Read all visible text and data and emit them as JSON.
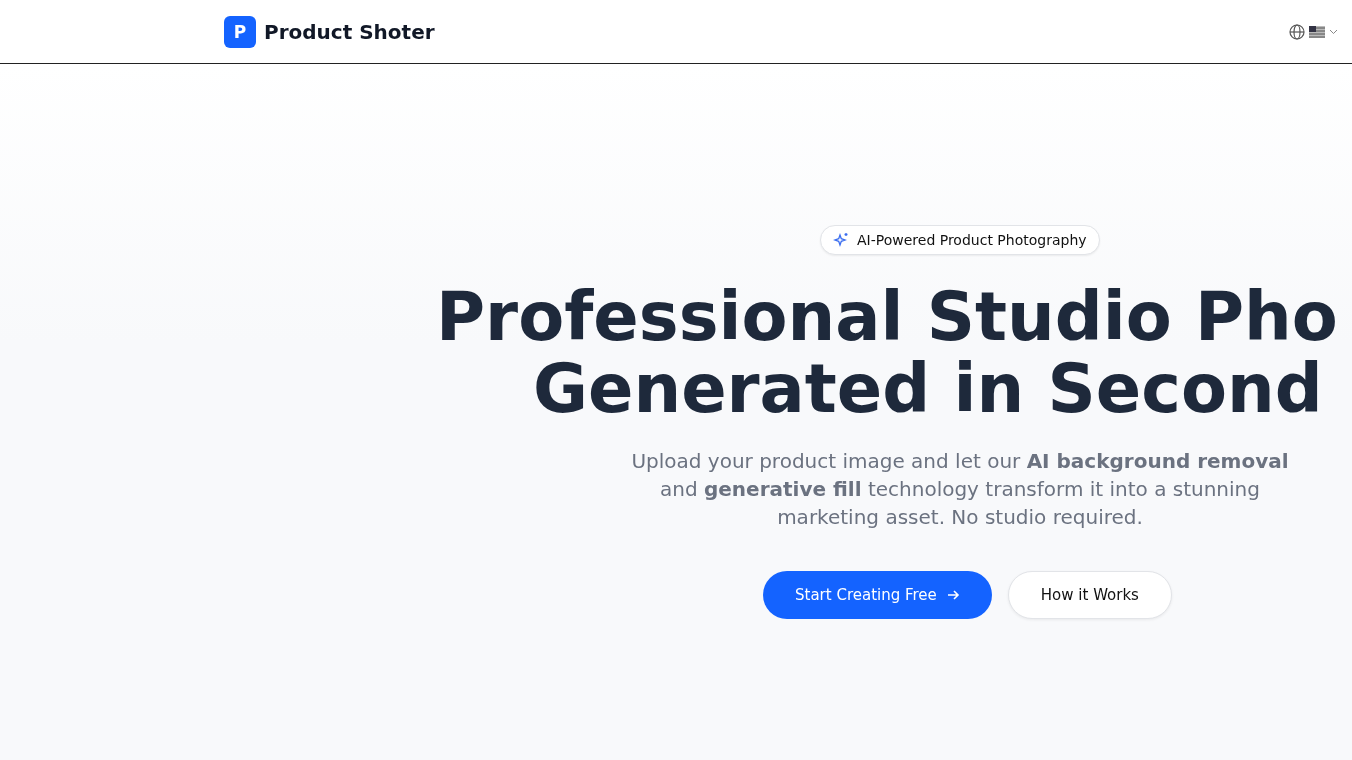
{
  "header": {
    "logo_letter": "P",
    "brand": "Product Shoter"
  },
  "hero": {
    "badge": "AI-Powered Product Photography",
    "title_lines": [
      "Professional Studio Pho",
      "Generated in Second"
    ],
    "subtitle": "Upload your product image and let our **AI background removal** and **generative fill** technology transform it into a stunning marketing asset. No studio required.",
    "buttons": [
      {
        "label": "Start Creating Free",
        "kind": "primary"
      },
      {
        "label": "How it Works",
        "kind": "secondary"
      }
    ]
  }
}
